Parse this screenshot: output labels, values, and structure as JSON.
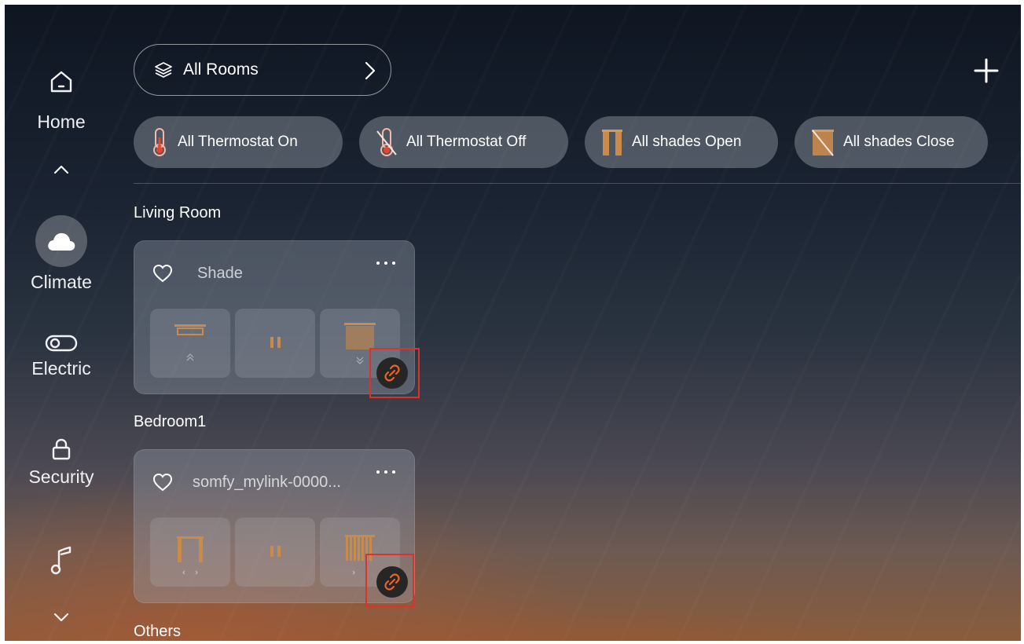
{
  "sidebar": {
    "items": [
      {
        "label": "Home",
        "icon": "home-icon"
      },
      {
        "label": "Climate",
        "icon": "cloud-icon",
        "active": true
      },
      {
        "label": "Electric",
        "icon": "toggle-icon"
      },
      {
        "label": "Security",
        "icon": "lock-icon"
      },
      {
        "label": "",
        "icon": "music-note-icon"
      }
    ]
  },
  "header": {
    "rooms_label": "All Rooms",
    "add_icon": "plus-icon"
  },
  "scenes": [
    {
      "label": "All Thermostat On",
      "icon": "thermometer-icon"
    },
    {
      "label": "All Thermostat Off",
      "icon": "thermometer-off-icon"
    },
    {
      "label": "All shades Open",
      "icon": "shades-open-icon"
    },
    {
      "label": "All shades Close",
      "icon": "shades-close-icon"
    }
  ],
  "sections": [
    {
      "title": "Living Room",
      "devices": [
        {
          "name": "Shade",
          "status": "offline",
          "controls": [
            "open",
            "pause",
            "close"
          ]
        }
      ]
    },
    {
      "title": "Bedroom1",
      "devices": [
        {
          "name": "somfy_mylink-0000...",
          "status": "offline",
          "controls": [
            "open",
            "pause",
            "close"
          ]
        }
      ]
    },
    {
      "title": "Others",
      "devices": []
    }
  ],
  "colors": {
    "accent_shade": "#c98a4a",
    "offline_icon": "#e8652b",
    "highlight_box": "#e0302a"
  }
}
